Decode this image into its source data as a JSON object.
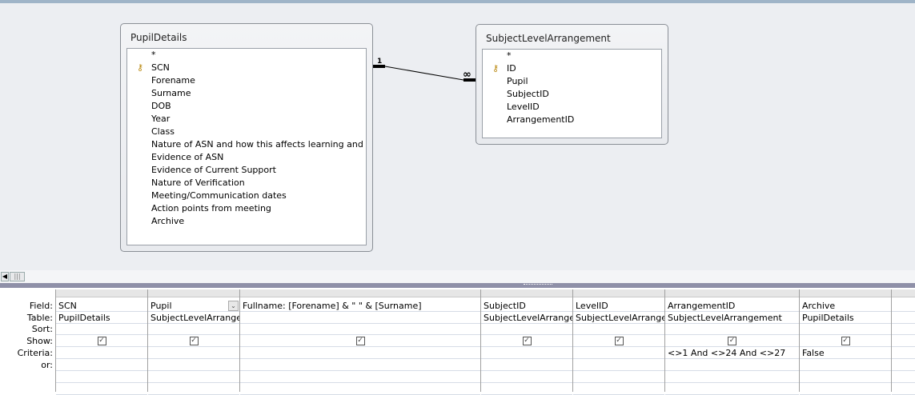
{
  "tables": [
    {
      "name": "PupilDetails",
      "fields": [
        "*",
        "SCN",
        "Forename",
        "Surname",
        "DOB",
        "Year",
        "Class",
        "Nature of ASN and how this affects learning and tea",
        "Evidence of ASN",
        "Evidence of Current Support",
        "Nature of Verification",
        "Meeting/Communication dates",
        "Action points from meeting",
        "Archive"
      ],
      "key_field": "SCN"
    },
    {
      "name": "SubjectLevelArrangement",
      "fields": [
        "*",
        "ID",
        "Pupil",
        "SubjectID",
        "LevelID",
        "ArrangementID"
      ],
      "key_field": "ID"
    }
  ],
  "relationship": {
    "one": "1",
    "many": "∞"
  },
  "grid": {
    "row_labels": [
      "Field:",
      "Table:",
      "Sort:",
      "Show:",
      "Criteria:",
      "or:"
    ],
    "columns": [
      {
        "field": "SCN",
        "table": "PupilDetails",
        "sort": "",
        "show": true,
        "criteria": "",
        "or": ""
      },
      {
        "field": "Pupil",
        "table": "SubjectLevelArrangem",
        "sort": "",
        "show": true,
        "criteria": "",
        "or": ""
      },
      {
        "field": "Fullname: [Forename] & \" \" & [Surname]",
        "table": "",
        "sort": "",
        "show": true,
        "criteria": "",
        "or": ""
      },
      {
        "field": "SubjectID",
        "table": "SubjectLevelArrangem",
        "sort": "",
        "show": true,
        "criteria": "",
        "or": ""
      },
      {
        "field": "LevelID",
        "table": "SubjectLevelArrangem",
        "sort": "",
        "show": true,
        "criteria": "",
        "or": ""
      },
      {
        "field": "ArrangementID",
        "table": "SubjectLevelArrangement",
        "sort": "",
        "show": true,
        "criteria": "<>1 And <>24 And <>27",
        "or": ""
      },
      {
        "field": "Archive",
        "table": "PupilDetails",
        "sort": "",
        "show": true,
        "criteria": "False",
        "or": ""
      },
      {
        "field": "",
        "table": "",
        "sort": "",
        "show": false,
        "criteria": "",
        "or": ""
      }
    ]
  }
}
